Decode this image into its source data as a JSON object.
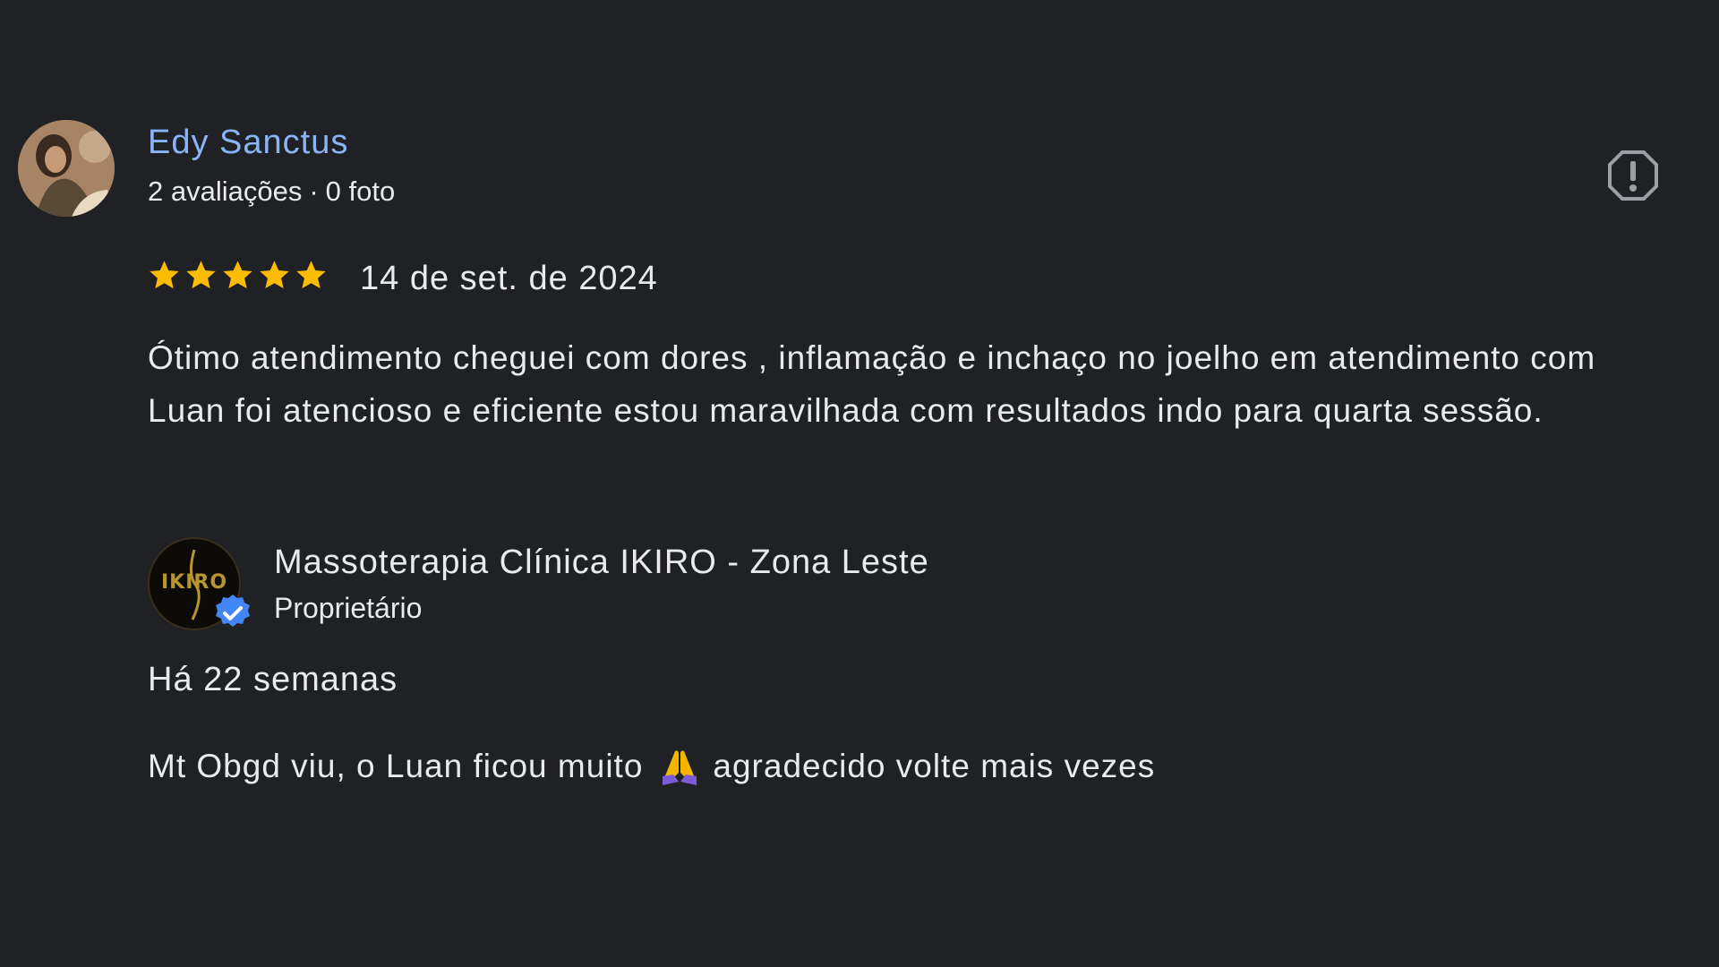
{
  "review": {
    "reviewer": {
      "name": "Edy Sanctus",
      "reviews_count": "2 avaliações",
      "separator": "·",
      "photos_count": "0 foto",
      "avatar_icon": "user-photo-avatar"
    },
    "report_icon": "flag-report-icon",
    "rating": 5,
    "rating_max": 5,
    "star_color": "#fbbc04",
    "date": "14 de set. de 2024",
    "text": "Ótimo atendimento cheguei com dores , inflamação e inchaço no joelho em atendimento com Luan foi atencioso e eficiente estou maravilhada com resultados indo para quarta sessão."
  },
  "owner_reply": {
    "logo_text": "IKIRO",
    "logo_color": "#b8962e",
    "verified_badge_color": "#4285f4",
    "name": "Massoterapia Clínica IKIRO - Zona Leste",
    "role": "Proprietário",
    "date": "Há 22 semanas",
    "text_before_emoji": "Mt Obgd viu, o Luan ficou muito",
    "emoji": "folded-hands-emoji",
    "text_after_emoji": "agradecido volte mais vezes"
  },
  "colors": {
    "background": "#202124",
    "link": "#8ab4f8",
    "text": "#e8eaed"
  }
}
